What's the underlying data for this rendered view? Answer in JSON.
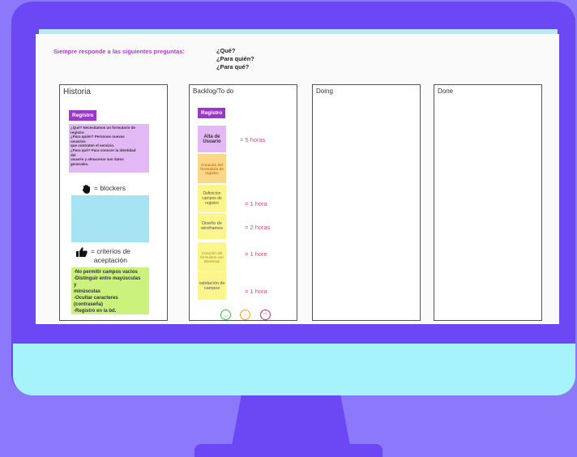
{
  "header": {
    "prompt": "Siempre responde a las siguientes preguntas:",
    "questions": [
      "¿Qué?",
      "¿Para quién?",
      "¿Para qué?"
    ]
  },
  "columns": {
    "historia": "Historia",
    "backlog": "Backlog/To do",
    "doing": "Doing",
    "done": "Done"
  },
  "historia": {
    "tag": "Registro",
    "note_lines": [
      "¿Qué? Necesitamos un formulario de",
      "registro",
      "¿Para quién? Personas nuevas",
      "usuarios",
      "que contraten el servicio.",
      "¿Para qué? Para conocer la identidad",
      "del",
      "usuario y almacenar sus datos",
      "generales."
    ],
    "blockers_label": "= blockers",
    "criteria_label_1": "= criterios de",
    "criteria_label_2": "aceptación",
    "criteria_lines": [
      "-No permitir campos vacíos",
      "-Distinguir entre mayúsculas",
      "y",
      "minúsculas",
      "-Ocultar caracteres",
      "(contraseña)",
      "-Registro en la bd."
    ]
  },
  "backlog": {
    "tag": "Registro",
    "tasks": [
      {
        "text": "Alta de Usuario",
        "color": "#e2b8f5",
        "estimate": "=  5  horas"
      },
      {
        "text": "Creación del formulario de registro",
        "color": "#fbd78a",
        "estimate": ""
      },
      {
        "text": "Definición campos de registro",
        "color": "#fbf58c",
        "estimate": "= 1 hora"
      },
      {
        "text": "Diseño de wireframes",
        "color": "#fbf58c",
        "estimate": "= 2 horas"
      },
      {
        "text": "Creación del formulario con Bootstrap",
        "color": "#fbf58c",
        "estimate": "= 1 hore"
      },
      {
        "text": "validación de campos",
        "color": "#fbf58c",
        "estimate": "= 1 hora"
      }
    ],
    "faces": [
      {
        "icon": "happy-face-icon",
        "color": "#3fb84a"
      },
      {
        "icon": "neutral-face-icon",
        "color": "#f0a030"
      },
      {
        "icon": "sad-face-icon",
        "color": "#c0306a"
      }
    ]
  },
  "colors": {
    "monitor": "#6c48f4",
    "background": "#8b78fb",
    "bezel": "#a6f3fb",
    "accent_purple": "#b23ad0"
  }
}
